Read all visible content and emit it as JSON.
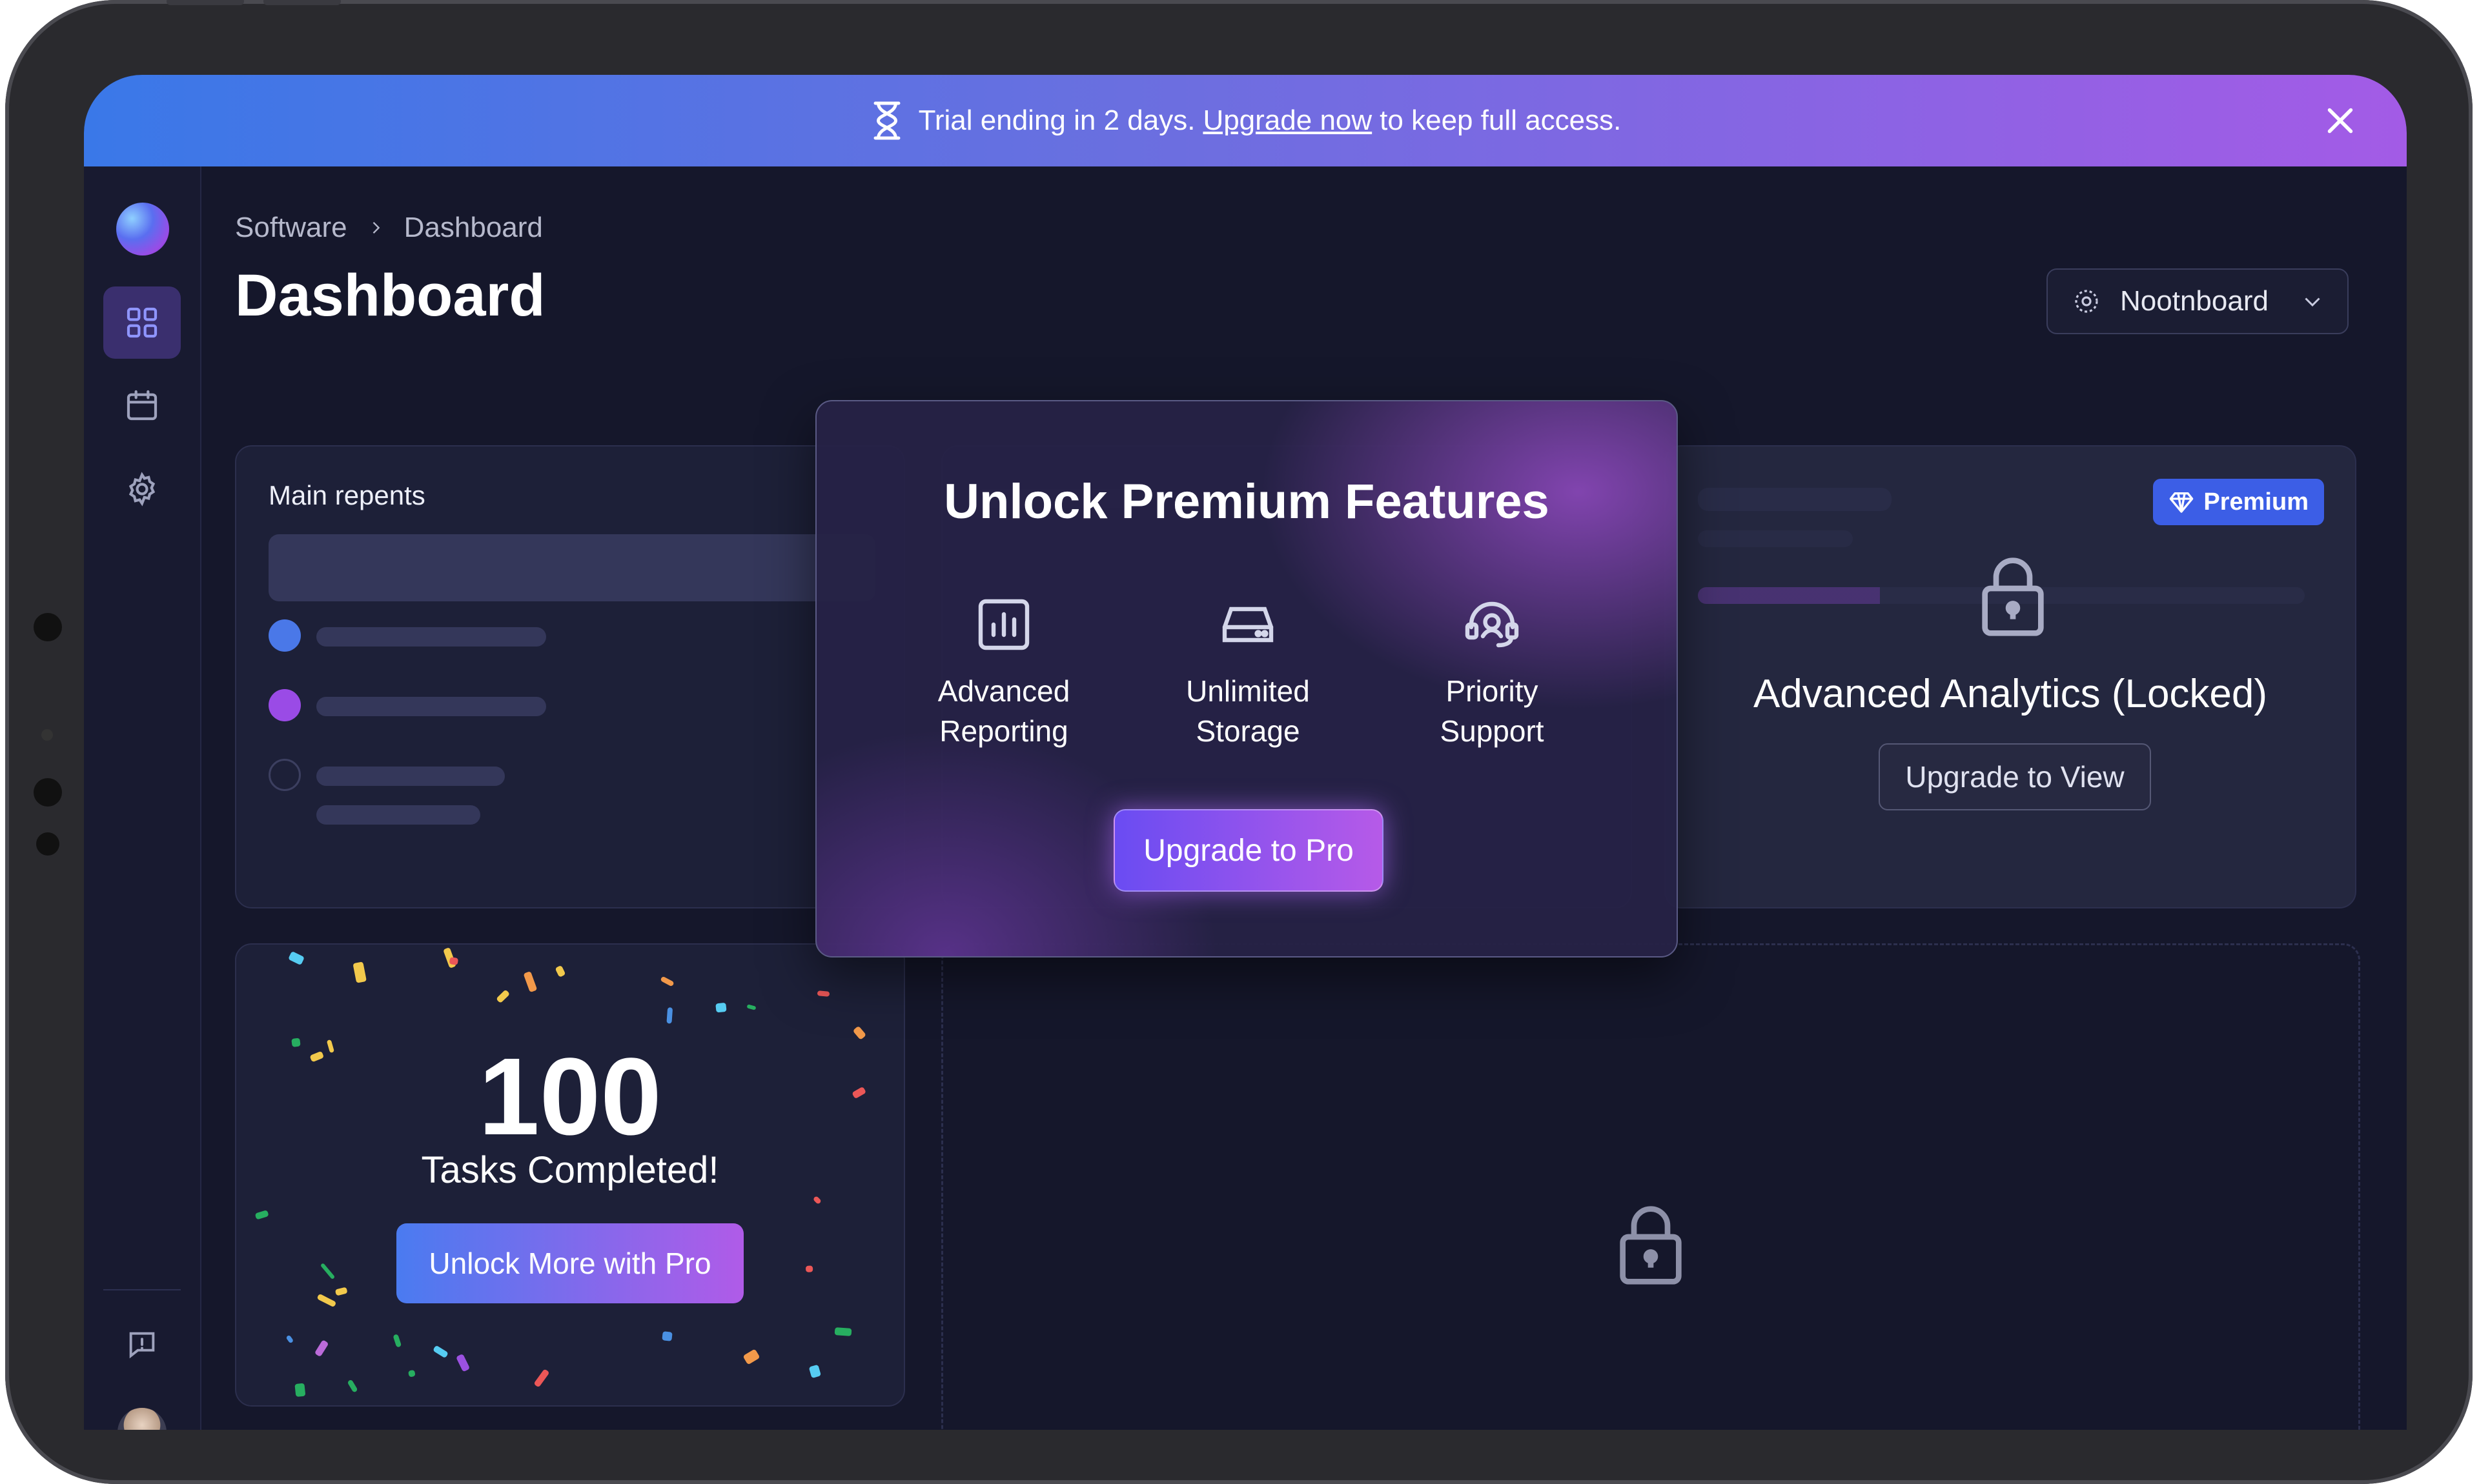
{
  "banner": {
    "text_before": "Trial ending in 2 days.",
    "link": "Upgrade now",
    "text_after": "to keep full access."
  },
  "breadcrumb": [
    "Software",
    "Dashboard"
  ],
  "page_title": "Dashboard",
  "workspace": {
    "name": "Nootnboard"
  },
  "cards": {
    "main_reports": {
      "title": "Main repents"
    },
    "analytics": {
      "badge": "Premium",
      "locked_title": "Advanced Analytics (Locked)",
      "button": "Upgrade to View"
    },
    "tasks": {
      "count": "100",
      "label": "Tasks Completed!",
      "button": "Unlock More with Pro"
    }
  },
  "modal": {
    "title": "Unlock Premium Features",
    "features": [
      {
        "line1": "Advanced",
        "line2": "Reporting",
        "icon": "bar-chart-icon"
      },
      {
        "line1": "Unlimited",
        "line2": "Storage",
        "icon": "hard-drive-icon"
      },
      {
        "line1": "Priority",
        "line2": "Support",
        "icon": "headset-icon"
      }
    ],
    "button": "Upgrade to Pro"
  },
  "colors": {
    "banner_start": "#3a78e8",
    "banner_end": "#a35be6",
    "premium_badge": "#3c5ee6",
    "accent_purple": "#9a4be6"
  }
}
